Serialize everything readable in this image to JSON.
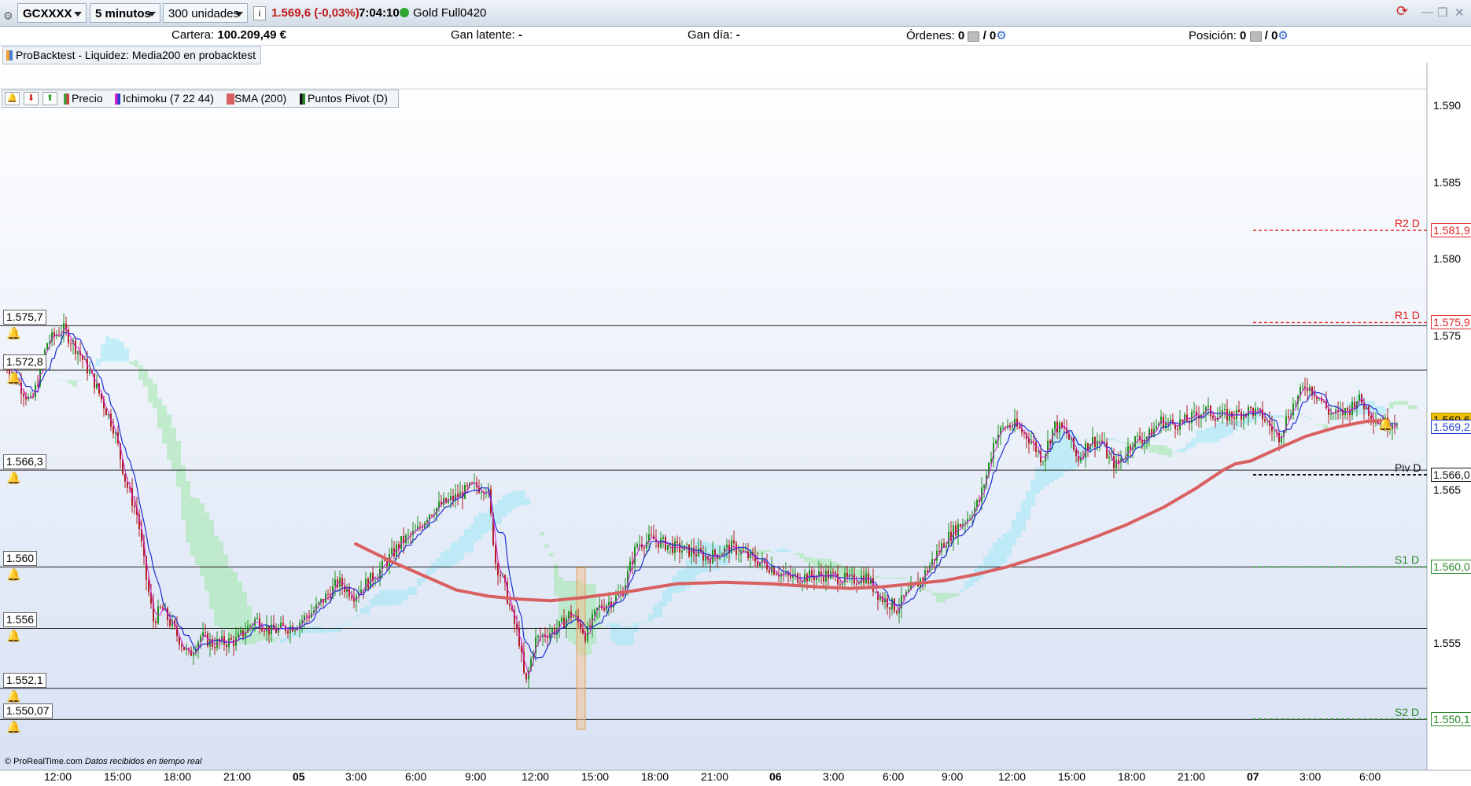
{
  "toolbar": {
    "symbol": "GCXXXX",
    "timeframe": "5 minutos",
    "units": "300 unidades",
    "info_icon": "info-icon",
    "last_price_change": "1.569,6 (-0,03%)",
    "time": "7:04:10",
    "market_status_color": "#2fa52f",
    "instrument_name": "Gold Full0420"
  },
  "account": {
    "cartera_label": "Cartera:",
    "cartera_value": "100.209,49 €",
    "gan_latente_label": "Gan latente:",
    "gan_latente_value": "-",
    "gan_dia_label": "Gan día:",
    "gan_dia_value": "-",
    "ordenes_label": "Órdenes:",
    "ordenes_a": "0",
    "ordenes_b": "/ 0",
    "posicion_label": "Posición:",
    "posicion_a": "0",
    "posicion_b": "/ 0"
  },
  "strategy": {
    "label": "ProBacktest - Liquidez: Media200 en probacktest"
  },
  "legend": {
    "items": [
      {
        "label": "Precio",
        "color": "#3fa03f"
      },
      {
        "label": "Ichimoku (7 22 44)",
        "color": "#d020d0"
      },
      {
        "label": "SMA (200)",
        "color": "#d96060"
      },
      {
        "label": "Puntos Pivot (D)",
        "color": "#111111"
      }
    ]
  },
  "axis": {
    "y_ticks": [
      "1.590",
      "1.585",
      "1.580",
      "1.575",
      "1.565",
      "1.555"
    ],
    "x_ticks": [
      "12:00",
      "15:00",
      "18:00",
      "21:00",
      "05",
      "3:00",
      "6:00",
      "9:00",
      "12:00",
      "15:00",
      "18:00",
      "21:00",
      "06",
      "3:00",
      "6:00",
      "9:00",
      "12:00",
      "15:00",
      "18:00",
      "21:00",
      "07",
      "3:00",
      "6:00"
    ]
  },
  "horizontal_lines": [
    {
      "label": "1.575,7",
      "value": 1575.7
    },
    {
      "label": "1.572,8",
      "value": 1572.8
    },
    {
      "label": "1.566,3",
      "value": 1566.3
    },
    {
      "label": "1.560",
      "value": 1560.0
    },
    {
      "label": "1.556",
      "value": 1556.0
    },
    {
      "label": "1.552,1",
      "value": 1552.1
    },
    {
      "label": "1.550,07",
      "value": 1550.07
    }
  ],
  "pivots": [
    {
      "name": "R2 D",
      "label": "1.581,9",
      "value": 1581.9,
      "color": "#e02020"
    },
    {
      "name": "R1 D",
      "label": "1.575,9",
      "value": 1575.9,
      "color": "#e02020"
    },
    {
      "name": "Piv D",
      "label": "1.566,0",
      "value": 1566.0,
      "color": "#111111"
    },
    {
      "name": "S1 D",
      "label": "1.560,0",
      "value": 1560.0,
      "color": "#2a8a2a"
    },
    {
      "name": "S2 D",
      "label": "1.550,1",
      "value": 1550.1,
      "color": "#2a8a2a"
    }
  ],
  "price_labels": {
    "last": {
      "label": "1.569,6",
      "value": 1569.6,
      "color": "#f0c000"
    },
    "ichimoku": {
      "label": "1.569,2",
      "value": 1569.2,
      "color": "#2040d0"
    }
  },
  "footer": {
    "brand": "© ProRealTime.com",
    "status": "Datos recibidos en tiempo real"
  }
}
